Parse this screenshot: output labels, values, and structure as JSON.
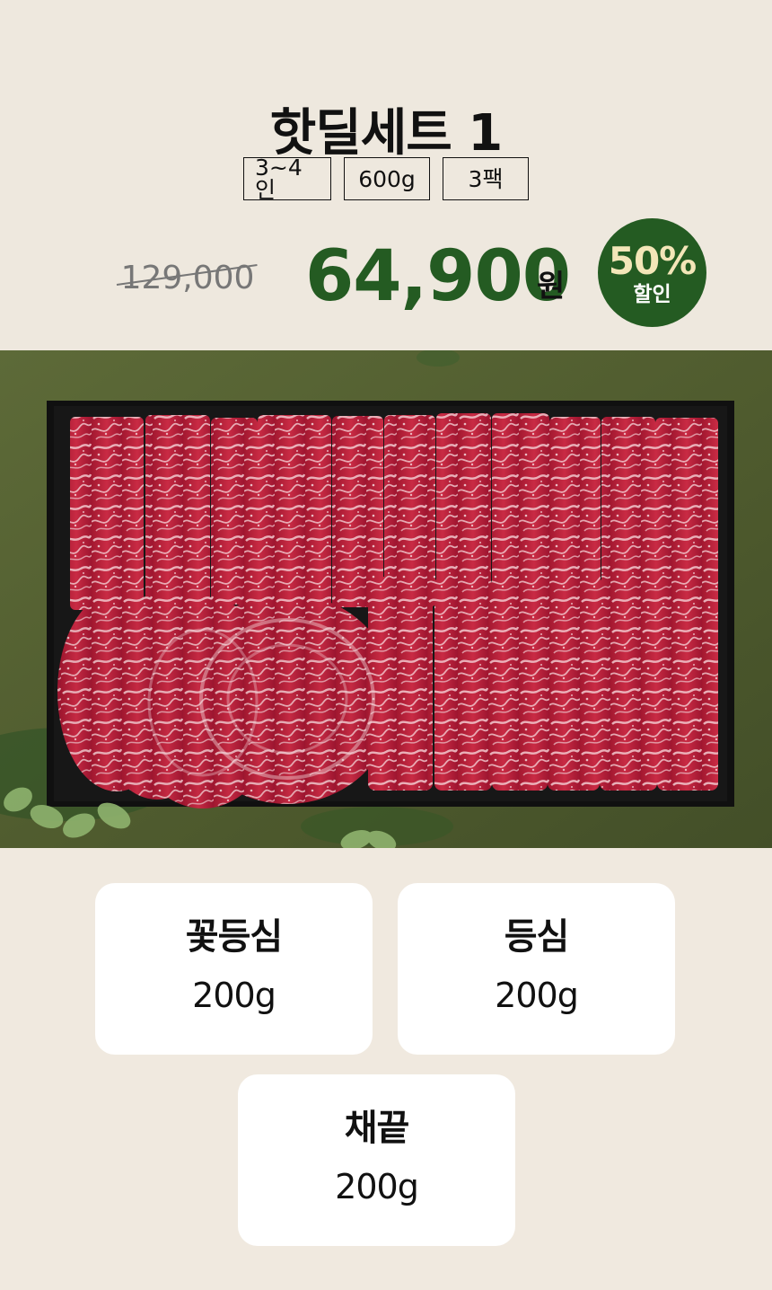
{
  "product": {
    "title": "핫딜세트 1",
    "tags": [
      "3~4인",
      "600g",
      "3팩"
    ],
    "original_price": "129,000",
    "sale_price": "64,900",
    "currency": "원",
    "discount": {
      "rate": "50%",
      "label": "할인"
    }
  },
  "components": [
    {
      "name": "꽃등심",
      "weight": "200g"
    },
    {
      "name": "등심",
      "weight": "200g"
    },
    {
      "name": "채끝",
      "weight": "200g"
    }
  ],
  "colors": {
    "page_background": "#F0E9DF",
    "header_background": "#EEE8DE",
    "accent_green": "#245B22",
    "accent_text_cream": "#F3E6B8",
    "card_background": "#FFFFFF"
  }
}
